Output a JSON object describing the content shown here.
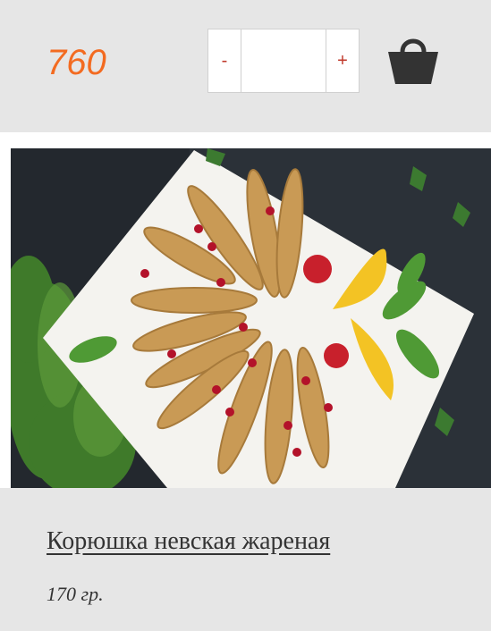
{
  "product": {
    "price": "760",
    "quantity": {
      "minus_label": "-",
      "plus_label": "+",
      "value": ""
    },
    "cart_icon": "shopping-basket-icon",
    "image_alt": "Корюшка невская жареная",
    "title": "Корюшка невская жареная",
    "weight": "170 гр."
  },
  "colors": {
    "price": "#f36b21",
    "quantity_buttons": "#c0392b",
    "panel_background": "#e6e6e6",
    "cart_icon": "#333333"
  }
}
